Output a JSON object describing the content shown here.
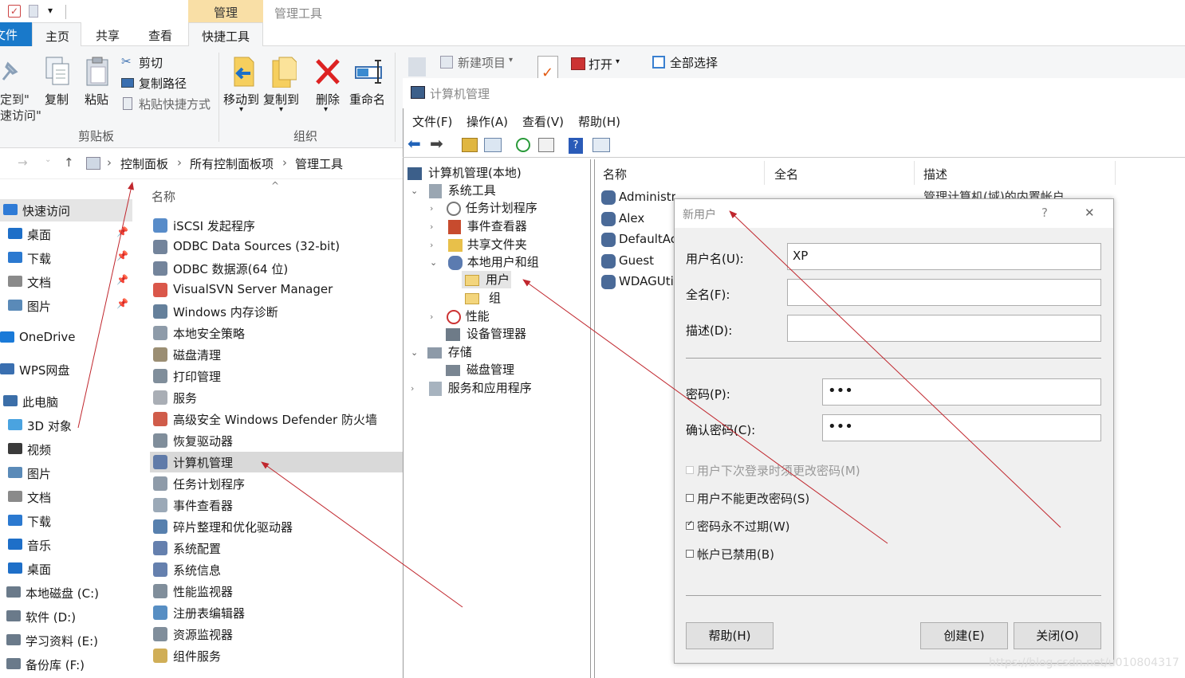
{
  "explorer": {
    "context_tab": "管理",
    "window_title": "管理工具",
    "tabs": {
      "file": "文件",
      "home": "主页",
      "share": "共享",
      "view": "查看",
      "shortcut_tools": "快捷工具"
    },
    "ribbon": {
      "pin": "固定到\"快速访问\"",
      "pin_line1": "定到\"",
      "pin_line2": "速访问\"",
      "copy": "复制",
      "paste": "粘贴",
      "cut": "剪切",
      "copy_path": "复制路径",
      "paste_shortcut": "粘贴快捷方式",
      "clipboard_group": "剪贴板",
      "move_to": "移动到",
      "copy_to": "复制到",
      "delete": "删除",
      "rename": "重命名",
      "organize_group": "组织",
      "new_item": "新建项目",
      "open": "打开",
      "select_all": "全部选择"
    },
    "breadcrumb": [
      "控制面板",
      "所有控制面板项",
      "管理工具"
    ],
    "column_name": "名称",
    "nav": [
      "快速访问",
      "桌面",
      "下载",
      "文档",
      "图片",
      "OneDrive",
      "WPS网盘",
      "此电脑",
      "3D 对象",
      "视频",
      "图片",
      "文档",
      "下载",
      "音乐",
      "桌面",
      "本地磁盘 (C:)",
      "软件 (D:)",
      "学习资料 (E:)",
      "备份库 (F:)"
    ],
    "files": [
      "iSCSI 发起程序",
      "ODBC Data Sources (32-bit)",
      "ODBC 数据源(64 位)",
      "VisualSVN Server Manager",
      "Windows 内存诊断",
      "本地安全策略",
      "磁盘清理",
      "打印管理",
      "服务",
      "高级安全 Windows Defender 防火墙",
      "恢复驱动器",
      "计算机管理",
      "任务计划程序",
      "事件查看器",
      "碎片整理和优化驱动器",
      "系统配置",
      "系统信息",
      "性能监视器",
      "注册表编辑器",
      "资源监视器",
      "组件服务"
    ]
  },
  "mmc": {
    "title": "计算机管理",
    "menu": [
      "文件(F)",
      "操作(A)",
      "查看(V)",
      "帮助(H)"
    ],
    "tree": {
      "root": "计算机管理(本地)",
      "system_tools": "系统工具",
      "task_scheduler": "任务计划程序",
      "event_viewer": "事件查看器",
      "shared_folders": "共享文件夹",
      "local_users_groups": "本地用户和组",
      "users": "用户",
      "groups": "组",
      "performance": "性能",
      "device_manager": "设备管理器",
      "storage": "存储",
      "disk_management": "磁盘管理",
      "services_apps": "服务和应用程序"
    },
    "columns": [
      "名称",
      "全名",
      "描述"
    ],
    "users": [
      "Administrator",
      "Alex",
      "DefaultAc",
      "Guest",
      "WDAGUti"
    ],
    "admin_desc": "管理计算机(域)的内置帐户"
  },
  "dialog": {
    "title": "新用户",
    "help_glyph": "?",
    "close_glyph": "✕",
    "username_label": "用户名(U):",
    "username_value": "XP",
    "fullname_label": "全名(F):",
    "fullname_value": "",
    "desc_label": "描述(D):",
    "desc_value": "",
    "password_label": "密码(P):",
    "password_value": "•••",
    "confirm_label": "确认密码(C):",
    "confirm_value": "•••",
    "chk_must_change": "用户下次登录时须更改密码(M)",
    "chk_cannot_change": "用户不能更改密码(S)",
    "chk_never_expires": "密码永不过期(W)",
    "chk_disabled": "帐户已禁用(B)",
    "must_change_checked": false,
    "cannot_change_checked": false,
    "never_expires_checked": true,
    "disabled_checked": false,
    "help_button": "帮助(H)",
    "create_button": "创建(E)",
    "close_button": "关闭(O)"
  },
  "watermark": "https://blog.csdn.net/u010804317",
  "colors": {
    "accent": "#1979ca",
    "context_tab": "#f9dfa6",
    "arrow": "#c0262d",
    "selection": "#d9d9d9"
  }
}
